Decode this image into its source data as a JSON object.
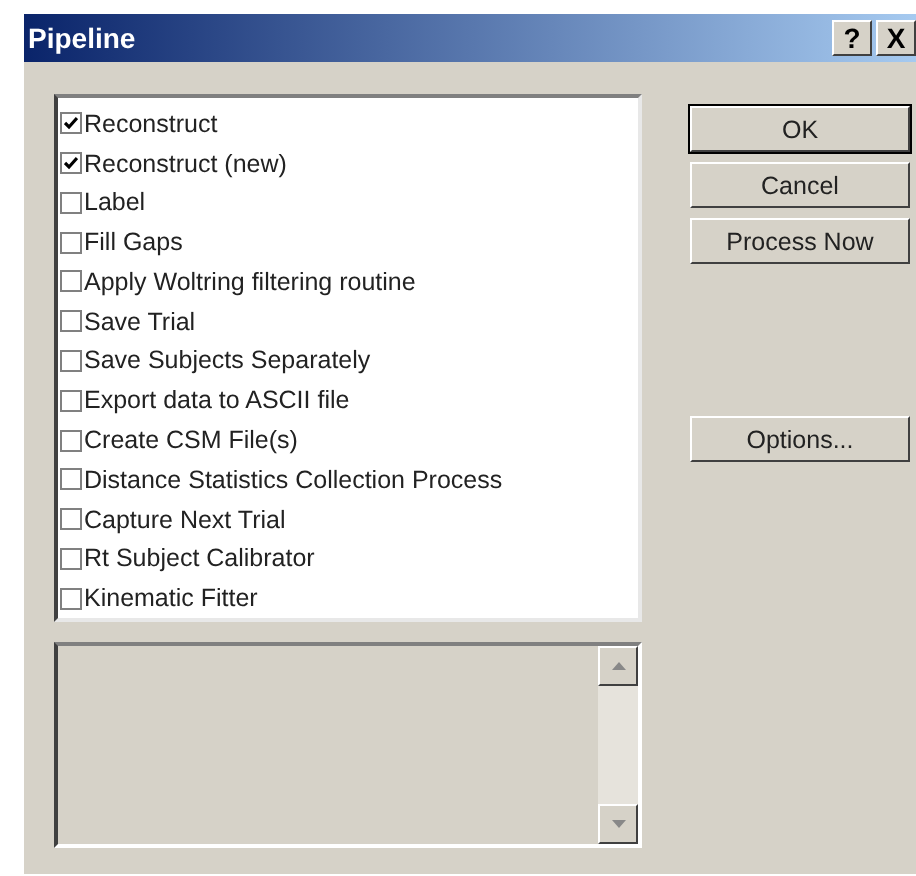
{
  "window": {
    "title": "Pipeline",
    "title_buttons": [
      "?",
      "X"
    ]
  },
  "pipeline_items": [
    {
      "label": "Reconstruct",
      "checked": true
    },
    {
      "label": "Reconstruct (new)",
      "checked": true
    },
    {
      "label": "Label",
      "checked": false
    },
    {
      "label": "Fill Gaps",
      "checked": false
    },
    {
      "label": "Apply Woltring filtering routine",
      "checked": false
    },
    {
      "label": "Save Trial",
      "checked": false
    },
    {
      "label": "Save Subjects Separately",
      "checked": false
    },
    {
      "label": "Export data to ASCII file",
      "checked": false
    },
    {
      "label": "Create CSM File(s)",
      "checked": false
    },
    {
      "label": "Distance Statistics Collection Process",
      "checked": false
    },
    {
      "label": "Capture Next Trial",
      "checked": false
    },
    {
      "label": "Rt Subject Calibrator",
      "checked": false
    },
    {
      "label": "Kinematic Fitter",
      "checked": false
    }
  ],
  "buttons": [
    {
      "label": "OK",
      "kind": "default"
    },
    {
      "label": "Cancel",
      "kind": "normal"
    },
    {
      "label": "Process Now",
      "kind": "normal"
    },
    {
      "label": "Options...",
      "kind": "spaced"
    }
  ]
}
